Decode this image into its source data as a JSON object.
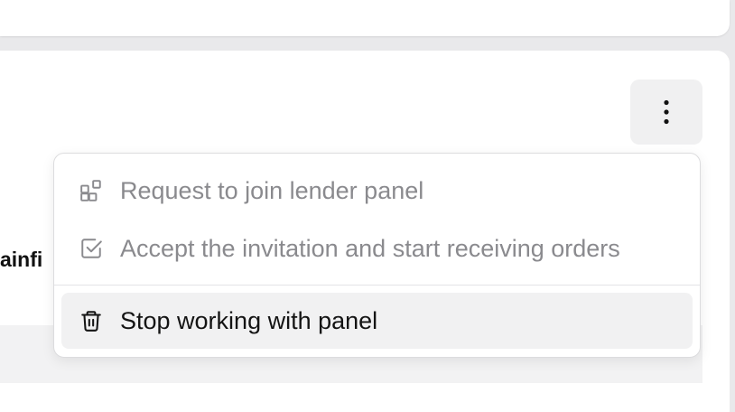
{
  "background_partial_text": "ainfi",
  "actions_button": {
    "icon": "more-vertical-icon"
  },
  "menu": {
    "items": [
      {
        "label": "Request to join lender panel",
        "icon": "blocks-icon",
        "state": "disabled"
      },
      {
        "label": "Accept the invitation and start receiving orders",
        "icon": "checkbox-icon",
        "state": "disabled"
      },
      {
        "label": "Stop working with panel",
        "icon": "trash-icon",
        "state": "highlighted"
      }
    ]
  },
  "colors": {
    "disabled_text": "#8a8a8e",
    "active_text": "#141414",
    "hover_bg": "#f1f1f2"
  }
}
